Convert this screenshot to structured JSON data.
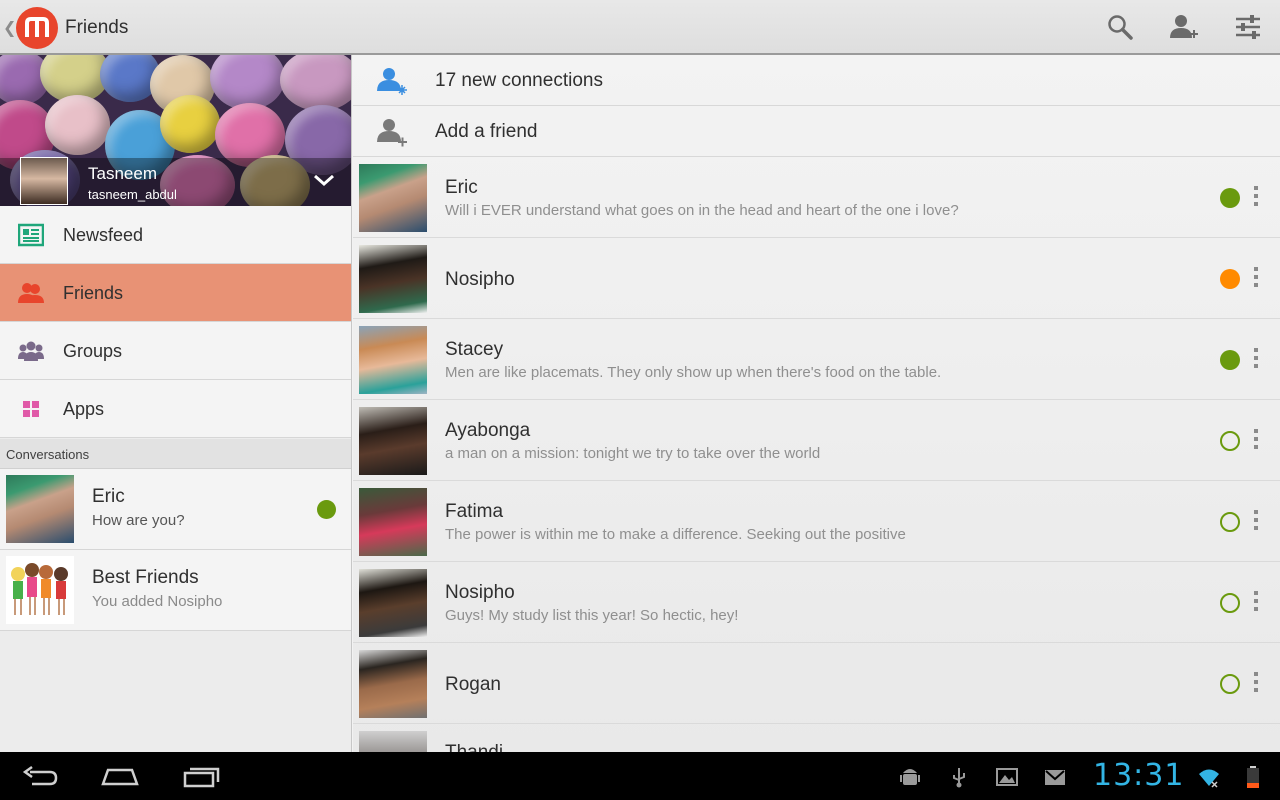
{
  "app": {
    "title": "Friends",
    "back_icon": "chevron-left-icon",
    "logo_icon": "mxit-logo-icon"
  },
  "actions": {
    "search_icon": "search-icon",
    "add_friend_icon": "person-plus-icon",
    "settings_icon": "sliders-icon"
  },
  "profile": {
    "name": "Tasneem",
    "handle": "tasneem_abdul",
    "toggle_icon": "chevron-down-icon"
  },
  "nav": [
    {
      "label": "Newsfeed",
      "icon": "newspaper-icon",
      "active": false
    },
    {
      "label": "Friends",
      "icon": "friends-icon",
      "active": true
    },
    {
      "label": "Groups",
      "icon": "groups-icon",
      "active": false
    },
    {
      "label": "Apps",
      "icon": "apps-grid-icon",
      "active": false
    }
  ],
  "conversations": {
    "header": "Conversations",
    "items": [
      {
        "name": "Eric",
        "message": "How are you?",
        "online": true
      },
      {
        "name": "Best Friends",
        "message": "You added Nosipho",
        "online": false
      }
    ]
  },
  "list_actions": [
    {
      "label": "17 new connections",
      "icon": "new-connections-icon"
    },
    {
      "label": "Add a friend",
      "icon": "person-plus-icon"
    }
  ],
  "friends": [
    {
      "name": "Eric",
      "status": "Will i EVER understand what goes on in the head and heart of the one i love?",
      "presence": "online"
    },
    {
      "name": "Nosipho",
      "status": "",
      "presence": "away"
    },
    {
      "name": "Stacey",
      "status": "Men are like placemats. They only show up when there's food on the table.",
      "presence": "online"
    },
    {
      "name": "Ayabonga",
      "status": "a man on a mission: tonight we try to take over the world",
      "presence": "offline"
    },
    {
      "name": "Fatima",
      "status": "The power is within me to make a difference. Seeking out the positive",
      "presence": "offline"
    },
    {
      "name": "Nosipho",
      "status": "Guys! My study list this year! So hectic, hey!",
      "presence": "offline"
    },
    {
      "name": "Rogan",
      "status": "",
      "presence": "offline"
    },
    {
      "name": "Thandi",
      "status": "",
      "presence": "offline"
    }
  ],
  "system_bar": {
    "time": "13:31",
    "nav_icons": [
      "back-icon",
      "home-icon",
      "recent-apps-icon"
    ],
    "status_icons": [
      "android-debug-icon",
      "usb-icon",
      "gallery-icon",
      "gmail-icon",
      "wifi-icon",
      "battery-icon"
    ]
  },
  "colors": {
    "accent": "#e8452c",
    "active_nav": "#e89275",
    "online": "#6a9a0e",
    "away": "#ff8a00",
    "clock": "#33b5e5"
  }
}
